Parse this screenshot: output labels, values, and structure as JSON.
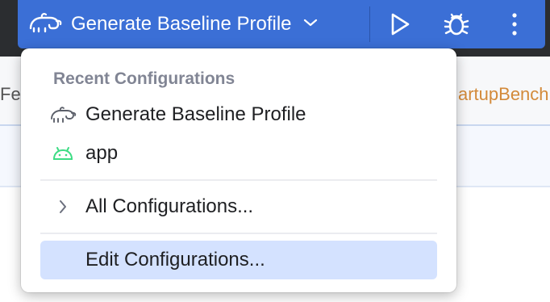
{
  "toolbar": {
    "config_name": "Generate Baseline Profile",
    "icons": {
      "config": "baseline-profile-icon",
      "dropdown": "chevron-down-icon",
      "run": "run-icon",
      "debug": "debug-icon",
      "more": "more-vertical-icon"
    }
  },
  "editor": {
    "tab_left": "Fe",
    "tab_right": "artupBench"
  },
  "popup": {
    "section_title": "Recent Configurations",
    "recent": [
      {
        "label": "Generate Baseline Profile",
        "icon": "baseline-profile-icon"
      },
      {
        "label": "app",
        "icon": "android-icon"
      }
    ],
    "all_configs": {
      "label": "All Configurations...",
      "icon": "chevron-right-icon"
    },
    "edit_configs": {
      "label": "Edit Configurations..."
    }
  },
  "colors": {
    "toolbar_bg": "#2b2d30",
    "run_widget": "#3b6fd6",
    "selection": "#d4e2ff",
    "android_green": "#3ddc84",
    "tab_orange": "#d38a3a"
  }
}
